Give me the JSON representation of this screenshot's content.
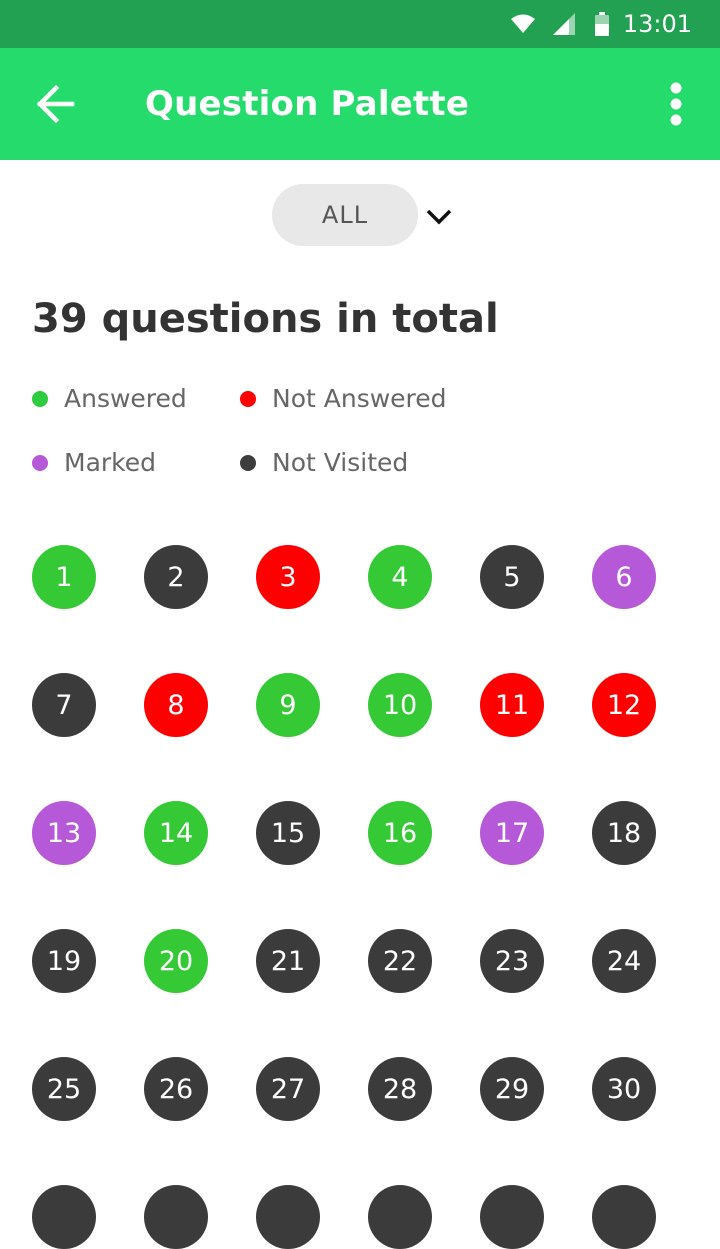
{
  "status_bar": {
    "time": "13:01"
  },
  "app_bar": {
    "title": "Question Palette"
  },
  "filter": {
    "label": "ALL"
  },
  "summary": {
    "total_text": "39 questions in total"
  },
  "legend": [
    {
      "label": "Answered",
      "color": "#2ecc40"
    },
    {
      "label": "Not Answered",
      "color": "#ff0000"
    },
    {
      "label": "Marked",
      "color": "#b659d8"
    },
    {
      "label": "Not Visited",
      "color": "#3d3d3d"
    }
  ],
  "colors": {
    "answered": "#35c935",
    "not_answered": "#ff0000",
    "marked": "#b659d8",
    "not_visited": "#3b3b3b",
    "app_bar": "#24db6c",
    "status_bar": "#23a152"
  },
  "questions": [
    {
      "number": "1",
      "status": "answered"
    },
    {
      "number": "2",
      "status": "not_visited"
    },
    {
      "number": "3",
      "status": "not_answered"
    },
    {
      "number": "4",
      "status": "answered"
    },
    {
      "number": "5",
      "status": "not_visited"
    },
    {
      "number": "6",
      "status": "marked"
    },
    {
      "number": "7",
      "status": "not_visited"
    },
    {
      "number": "8",
      "status": "not_answered"
    },
    {
      "number": "9",
      "status": "answered"
    },
    {
      "number": "10",
      "status": "answered"
    },
    {
      "number": "11",
      "status": "not_answered"
    },
    {
      "number": "12",
      "status": "not_answered"
    },
    {
      "number": "13",
      "status": "marked"
    },
    {
      "number": "14",
      "status": "answered"
    },
    {
      "number": "15",
      "status": "not_visited"
    },
    {
      "number": "16",
      "status": "answered"
    },
    {
      "number": "17",
      "status": "marked"
    },
    {
      "number": "18",
      "status": "not_visited"
    },
    {
      "number": "19",
      "status": "not_visited"
    },
    {
      "number": "20",
      "status": "answered"
    },
    {
      "number": "21",
      "status": "not_visited"
    },
    {
      "number": "22",
      "status": "not_visited"
    },
    {
      "number": "23",
      "status": "not_visited"
    },
    {
      "number": "24",
      "status": "not_visited"
    },
    {
      "number": "25",
      "status": "not_visited"
    },
    {
      "number": "26",
      "status": "not_visited"
    },
    {
      "number": "27",
      "status": "not_visited"
    },
    {
      "number": "28",
      "status": "not_visited"
    },
    {
      "number": "29",
      "status": "not_visited"
    },
    {
      "number": "30",
      "status": "not_visited"
    },
    {
      "number": "",
      "status": "not_visited"
    },
    {
      "number": "",
      "status": "not_visited"
    },
    {
      "number": "",
      "status": "not_visited"
    },
    {
      "number": "",
      "status": "not_visited"
    },
    {
      "number": "",
      "status": "not_visited"
    },
    {
      "number": "",
      "status": "not_visited"
    }
  ]
}
